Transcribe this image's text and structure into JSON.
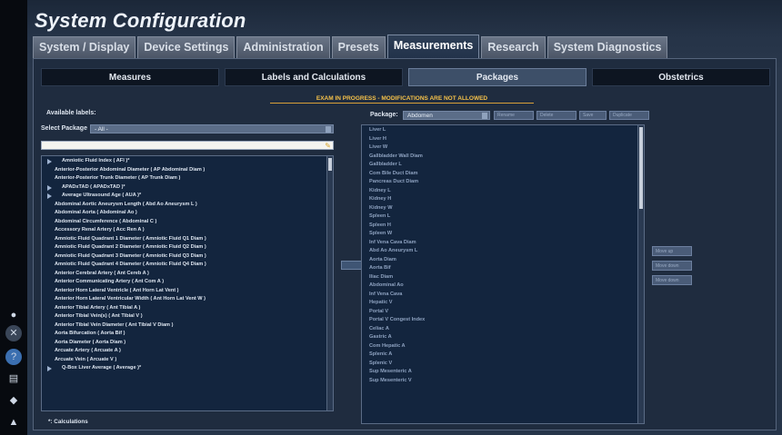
{
  "window": {
    "title": "System Configuration"
  },
  "tabs": [
    {
      "label": "System / Display",
      "active": false
    },
    {
      "label": "Device Settings",
      "active": false
    },
    {
      "label": "Administration",
      "active": false
    },
    {
      "label": "Presets",
      "active": false
    },
    {
      "label": "Measurements",
      "active": true
    },
    {
      "label": "Research",
      "active": false
    },
    {
      "label": "System Diagnostics",
      "active": false
    }
  ],
  "subtabs": [
    {
      "label": "Measures",
      "active": false
    },
    {
      "label": "Labels and Calculations",
      "active": false
    },
    {
      "label": "Packages",
      "active": true
    },
    {
      "label": "Obstetrics",
      "active": false
    }
  ],
  "warning": "EXAM IN PROGRESS - MODIFICATIONS ARE NOT ALLOWED",
  "available": {
    "heading": "Available labels:",
    "select_package_label": "Select Package",
    "select_package_value": "- All -",
    "search_value": "",
    "items": [
      {
        "label": "Amniotic Fluid Index ( AFI )*",
        "group": true
      },
      {
        "label": "Anterior-Posterior Abdominal Diameter ( AP Abdominal Diam )",
        "group": false
      },
      {
        "label": "Anterior-Posterior Trunk Diameter ( AP Trunk Diam )",
        "group": false
      },
      {
        "label": "APADxTAD ( APADxTAD )*",
        "group": true
      },
      {
        "label": "Average Ultrasound Age ( AUA )*",
        "group": true
      },
      {
        "label": "Abdominal Aortic Aneurysm Length ( Abd Ao Aneurysm L )",
        "group": false
      },
      {
        "label": "Abdominal Aorta ( Abdominal Ao )",
        "group": false
      },
      {
        "label": "Abdominal Circumference ( Abdominal C )",
        "group": false
      },
      {
        "label": "Accessory Renal Artery ( Acc Ren A )",
        "group": false
      },
      {
        "label": "Amniotic Fluid Quadrant 1 Diameter ( Amniotic Fluid Q1 Diam )",
        "group": false
      },
      {
        "label": "Amniotic Fluid Quadrant 2 Diameter ( Amniotic Fluid Q2 Diam )",
        "group": false
      },
      {
        "label": "Amniotic Fluid Quadrant 3 Diameter ( Amniotic Fluid Q3 Diam )",
        "group": false
      },
      {
        "label": "Amniotic Fluid Quadrant 4 Diameter ( Amniotic Fluid Q4 Diam )",
        "group": false
      },
      {
        "label": "Anterior Cerebral Artery ( Ant Cereb A )",
        "group": false
      },
      {
        "label": "Anterior Communicating Artery ( Ant Com A )",
        "group": false
      },
      {
        "label": "Anterior Horn Lateral Ventricle ( Ant Horn Lat Vent )",
        "group": false
      },
      {
        "label": "Anterior Horn Lateral Ventricular Width ( Ant Horn Lat Vent W )",
        "group": false
      },
      {
        "label": "Anterior Tibial Artery ( Ant Tibial A )",
        "group": false
      },
      {
        "label": "Anterior Tibial Vein(s) ( Ant Tibial V )",
        "group": false
      },
      {
        "label": "Anterior Tibial Vein Diameter ( Ant Tibial V Diam )",
        "group": false
      },
      {
        "label": "Aorta Bifurcation ( Aorta Bif )",
        "group": false
      },
      {
        "label": "Aorta Diameter ( Aorta Diam )",
        "group": false
      },
      {
        "label": "Arcuate Artery ( Arcuate A )",
        "group": false
      },
      {
        "label": "Arcuate Vein ( Arcuate V )",
        "group": false
      },
      {
        "label": "Q-Box Liver Average ( Average )*",
        "group": true
      }
    ],
    "calc_note": "*: Calculations"
  },
  "package": {
    "label": "Package:",
    "value": "Abdomen",
    "buttons": [
      "Rename",
      "Delete",
      "Save",
      "Duplicate"
    ],
    "items": [
      "Liver L",
      "Liver H",
      "Liver W",
      "Gallbladder Wall Diam",
      "Gallbladder L",
      "Com Bile Duct Diam",
      "Pancreas Duct Diam",
      "Kidney L",
      "Kidney H",
      "Kidney W",
      "Spleen L",
      "Spleen H",
      "Spleen W",
      "Inf Vena Cava Diam",
      "Abd Ao Aneurysm L",
      "Aorta Diam",
      "Aorta Bif",
      "Iliac Diam",
      "Abdominal Ao",
      "Inf Vena Cava",
      "Hepatic V",
      "Portal V",
      "Portal V Congest Index",
      "Celiac A",
      "Gastric A",
      "Com Hepatic A",
      "Splenic A",
      "Splenic V",
      "Sup Mesenteric A",
      "Sup Mesenteric V"
    ],
    "side_buttons": [
      "Move up",
      "Move down",
      "Move down"
    ]
  },
  "rail_icons": [
    "network-icon",
    "close-circle-icon",
    "help-icon",
    "printer-icon",
    "settings-icon",
    "user-icon"
  ]
}
